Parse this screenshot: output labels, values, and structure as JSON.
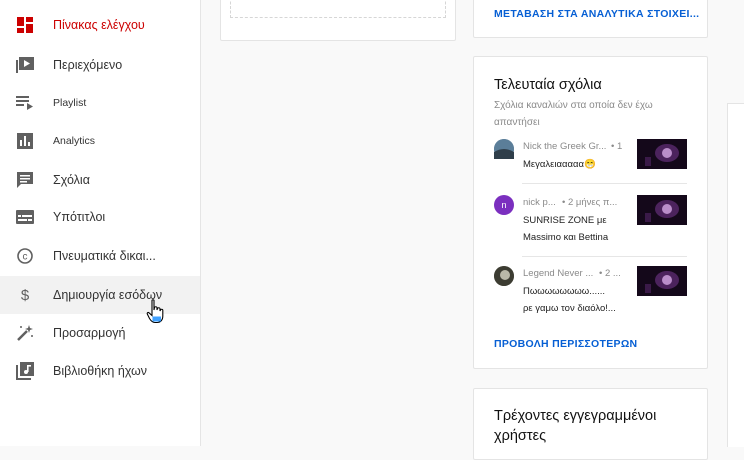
{
  "sidebar": {
    "items": [
      {
        "label": "Πίνακας ελέγχου",
        "icon": "dashboard-icon"
      },
      {
        "label": "Περιεχόμενο",
        "icon": "content-icon"
      },
      {
        "label": "Playlist",
        "icon": "playlist-icon"
      },
      {
        "label": "Analytics",
        "icon": "analytics-icon"
      },
      {
        "label": "Σχόλια",
        "icon": "comments-icon"
      },
      {
        "label": "Υπότιτλοι",
        "icon": "subtitles-icon"
      },
      {
        "label": "Πνευματικά δικαι...",
        "icon": "copyright-icon"
      },
      {
        "label": "Δημιουργία εσόδων",
        "icon": "dollar-icon"
      },
      {
        "label": "Προσαρμογή",
        "icon": "magic-wand-icon"
      },
      {
        "label": "Βιβλιοθήκη ήχων",
        "icon": "audio-library-icon"
      }
    ]
  },
  "analytics_card": {
    "link": "ΜΕΤΑΒΑΣΗ ΣΤΑ ΑΝΑΛΥΤΙΚΑ ΣΤΟΙΧΕΙ..."
  },
  "comments_card": {
    "title": "Τελευταία σχόλια",
    "subtitle_line1": "Σχόλια καναλιών στα οποία δεν έχω",
    "subtitle_line2": "απαντήσει",
    "comments": [
      {
        "author": "Nick the Greek Gr...",
        "meta": "• 1",
        "text_line1": "Μεγαλειααααα😁",
        "text_line2": "",
        "avatar_color": "#6f8fa8"
      },
      {
        "author": "nick p...",
        "meta": "• 2 μήνες π...",
        "text_line1": "SUNRISE ZONE με",
        "text_line2": "Massimo και Bettina",
        "avatar_color": "#7b2fbf",
        "avatar_letter": "n"
      },
      {
        "author": "Legend Never ...",
        "meta": "• 2 ...",
        "text_line1": "Πωωωωωωωω......",
        "text_line2": "ρε γαμω τον διαόλο!...",
        "avatar_color": "#8a8a7a"
      }
    ],
    "more_link": "ΠΡΟΒΟΛΗ ΠΕΡΙΣΣΟΤΕΡΩΝ"
  },
  "subscribers_card": {
    "title_line1": "Τρέχοντες εγγεγραμμένοι",
    "title_line2": "χρήστες"
  },
  "colors": {
    "accent_red": "#cc0000",
    "link_blue": "#065fd4"
  }
}
